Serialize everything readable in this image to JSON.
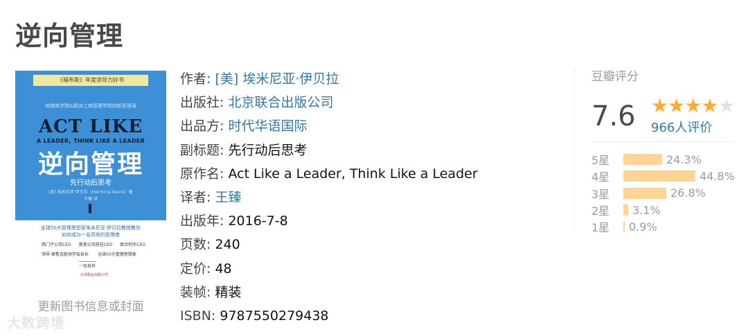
{
  "book": {
    "title": "逆向管理"
  },
  "cover": {
    "banner": "《福布斯》年度领导力好书",
    "line1": "哈佛商学院&欧洲工商管理学院创新管理课",
    "title_en": "ACT LIKE",
    "subtitle_en": "A LEADER, THINK LIKE A LEADER",
    "title_cn": "逆向管理",
    "subtitle_cn": "先行动后思考",
    "author": "[美] 埃米尼亚·伊贝拉（Herminia Ibarra）著",
    "translator": "王臻 译",
    "blurb1": "全球50大管理思想家埃米尼亚·伊贝拉教授教你",
    "blurb2": "如何成为一名高效的管理者",
    "endorse": [
      [
        "西门子公司CEO",
        "奥美公司前任CEO",
        "联合利华CEO"
      ],
      [
        "领导·德鲁克欧洲学会会长",
        "全球50大管理思想家",
        ""
      ]
    ],
    "recommend": "一致推荐",
    "publisher": "北京联合出版公司"
  },
  "edit_cover_link": "更新图书信息或封面",
  "watermark": "大数跨境",
  "info": {
    "author_label": "作者:",
    "author_value": "[美] 埃米尼亚·伊贝拉",
    "publisher_label": "出版社:",
    "publisher_value": "北京联合出版公司",
    "producer_label": "出品方:",
    "producer_value": "时代华语国际",
    "subtitle_label": "副标题:",
    "subtitle_value": "先行动后思考",
    "original_label": "原作名:",
    "original_value": "Act Like a Leader, Think Like a Leader",
    "translator_label": "译者:",
    "translator_value": "王臻",
    "date_label": "出版年:",
    "date_value": "2016-7-8",
    "pages_label": "页数:",
    "pages_value": "240",
    "price_label": "定价:",
    "price_value": "48",
    "binding_label": "装帧:",
    "binding_value": "精装",
    "isbn_label": "ISBN:",
    "isbn_value": "9787550279438"
  },
  "rating": {
    "header": "豆瓣评分",
    "score": "7.6",
    "stars_filled": 4,
    "stars_total": 5,
    "votes": "966人评价",
    "accent_color": "#ffac2d",
    "bar_color": "#ffd596",
    "breakdown": [
      {
        "label": "5星",
        "percent": "24.3%",
        "value": 24.3
      },
      {
        "label": "4星",
        "percent": "44.8%",
        "value": 44.8
      },
      {
        "label": "3星",
        "percent": "26.8%",
        "value": 26.8
      },
      {
        "label": "2星",
        "percent": "3.1%",
        "value": 3.1
      },
      {
        "label": "1星",
        "percent": "0.9%",
        "value": 0.9
      }
    ]
  }
}
